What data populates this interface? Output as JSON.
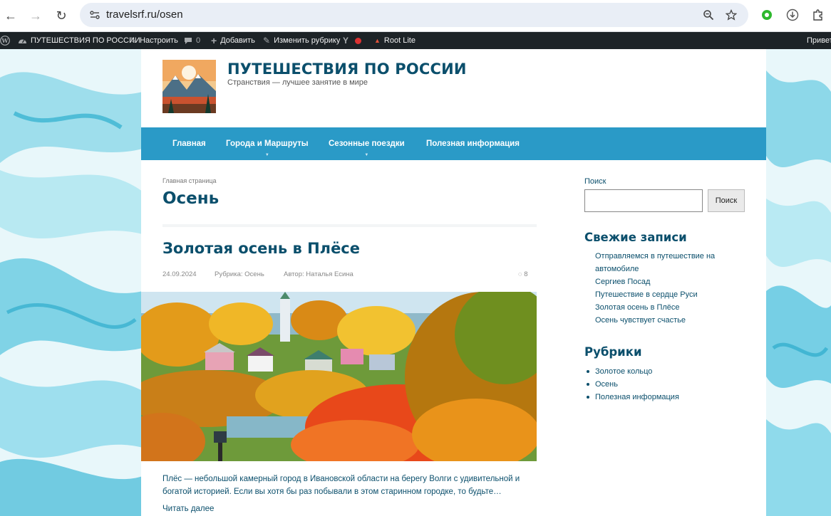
{
  "browser": {
    "url": "travelsrf.ru/osen",
    "back_icon": "←",
    "forward_icon": "→",
    "reload_icon": "↻",
    "site_info_icon": "⚙",
    "zoom_icon": "⊖",
    "star_icon": "☆",
    "download_icon": "⬇",
    "extensions_icon": "⧉"
  },
  "adminbar": {
    "wp_logo": "W",
    "site_name": "ПУТЕШЕСТВИЯ ПО РОССИИ",
    "customize": "Настроить",
    "comments_count": "0",
    "add_new": "Добавить",
    "edit_category": "Изменить рубрику",
    "yoast_badge": "Y",
    "root_lite": "Root Lite",
    "greeting": "Привет,"
  },
  "header": {
    "site_title": "ПУТЕШЕСТВИЯ ПО РОССИИ",
    "site_description": "Странствия — лучшее занятие в мире"
  },
  "menu": {
    "items": [
      {
        "label": "Главная",
        "has_children": false
      },
      {
        "label": "Города и Маршруты",
        "has_children": true
      },
      {
        "label": "Сезонные поездки",
        "has_children": true
      },
      {
        "label": "Полезная информация",
        "has_children": false
      }
    ]
  },
  "content": {
    "breadcrumb": "Главная страница",
    "archive_title": "Осень",
    "post": {
      "title": "Золотая осень в Плёсе",
      "date": "24.09.2024",
      "category": "Рубрика: Осень",
      "author": "Автор: Наталья Есина",
      "comments": "8",
      "excerpt": "Плёс — небольшой камерный город в Ивановской области на берегу Волги с удивительной и богатой историей. Если вы хотя бы раз побывали в этом старинном городке, то будьте…",
      "read_more": "Читать далее"
    }
  },
  "sidebar": {
    "search_label": "Поиск",
    "search_button": "Поиск",
    "search_value": "",
    "recent_title": "Свежие записи",
    "recent_posts": [
      "Отправляемся в путешествие на автомобиле",
      "Сергиев Посад",
      "Путешествие в сердце Руси",
      "Золотая осень в Плёсе",
      "Осень чувствует счастье"
    ],
    "categories_title": "Рубрики",
    "categories": [
      "Золотое кольцо",
      "Осень",
      "Полезная информация"
    ]
  },
  "colors": {
    "accent": "#2a9ac7",
    "heading": "#0b4f6c",
    "adminbar": "#1d2327"
  }
}
